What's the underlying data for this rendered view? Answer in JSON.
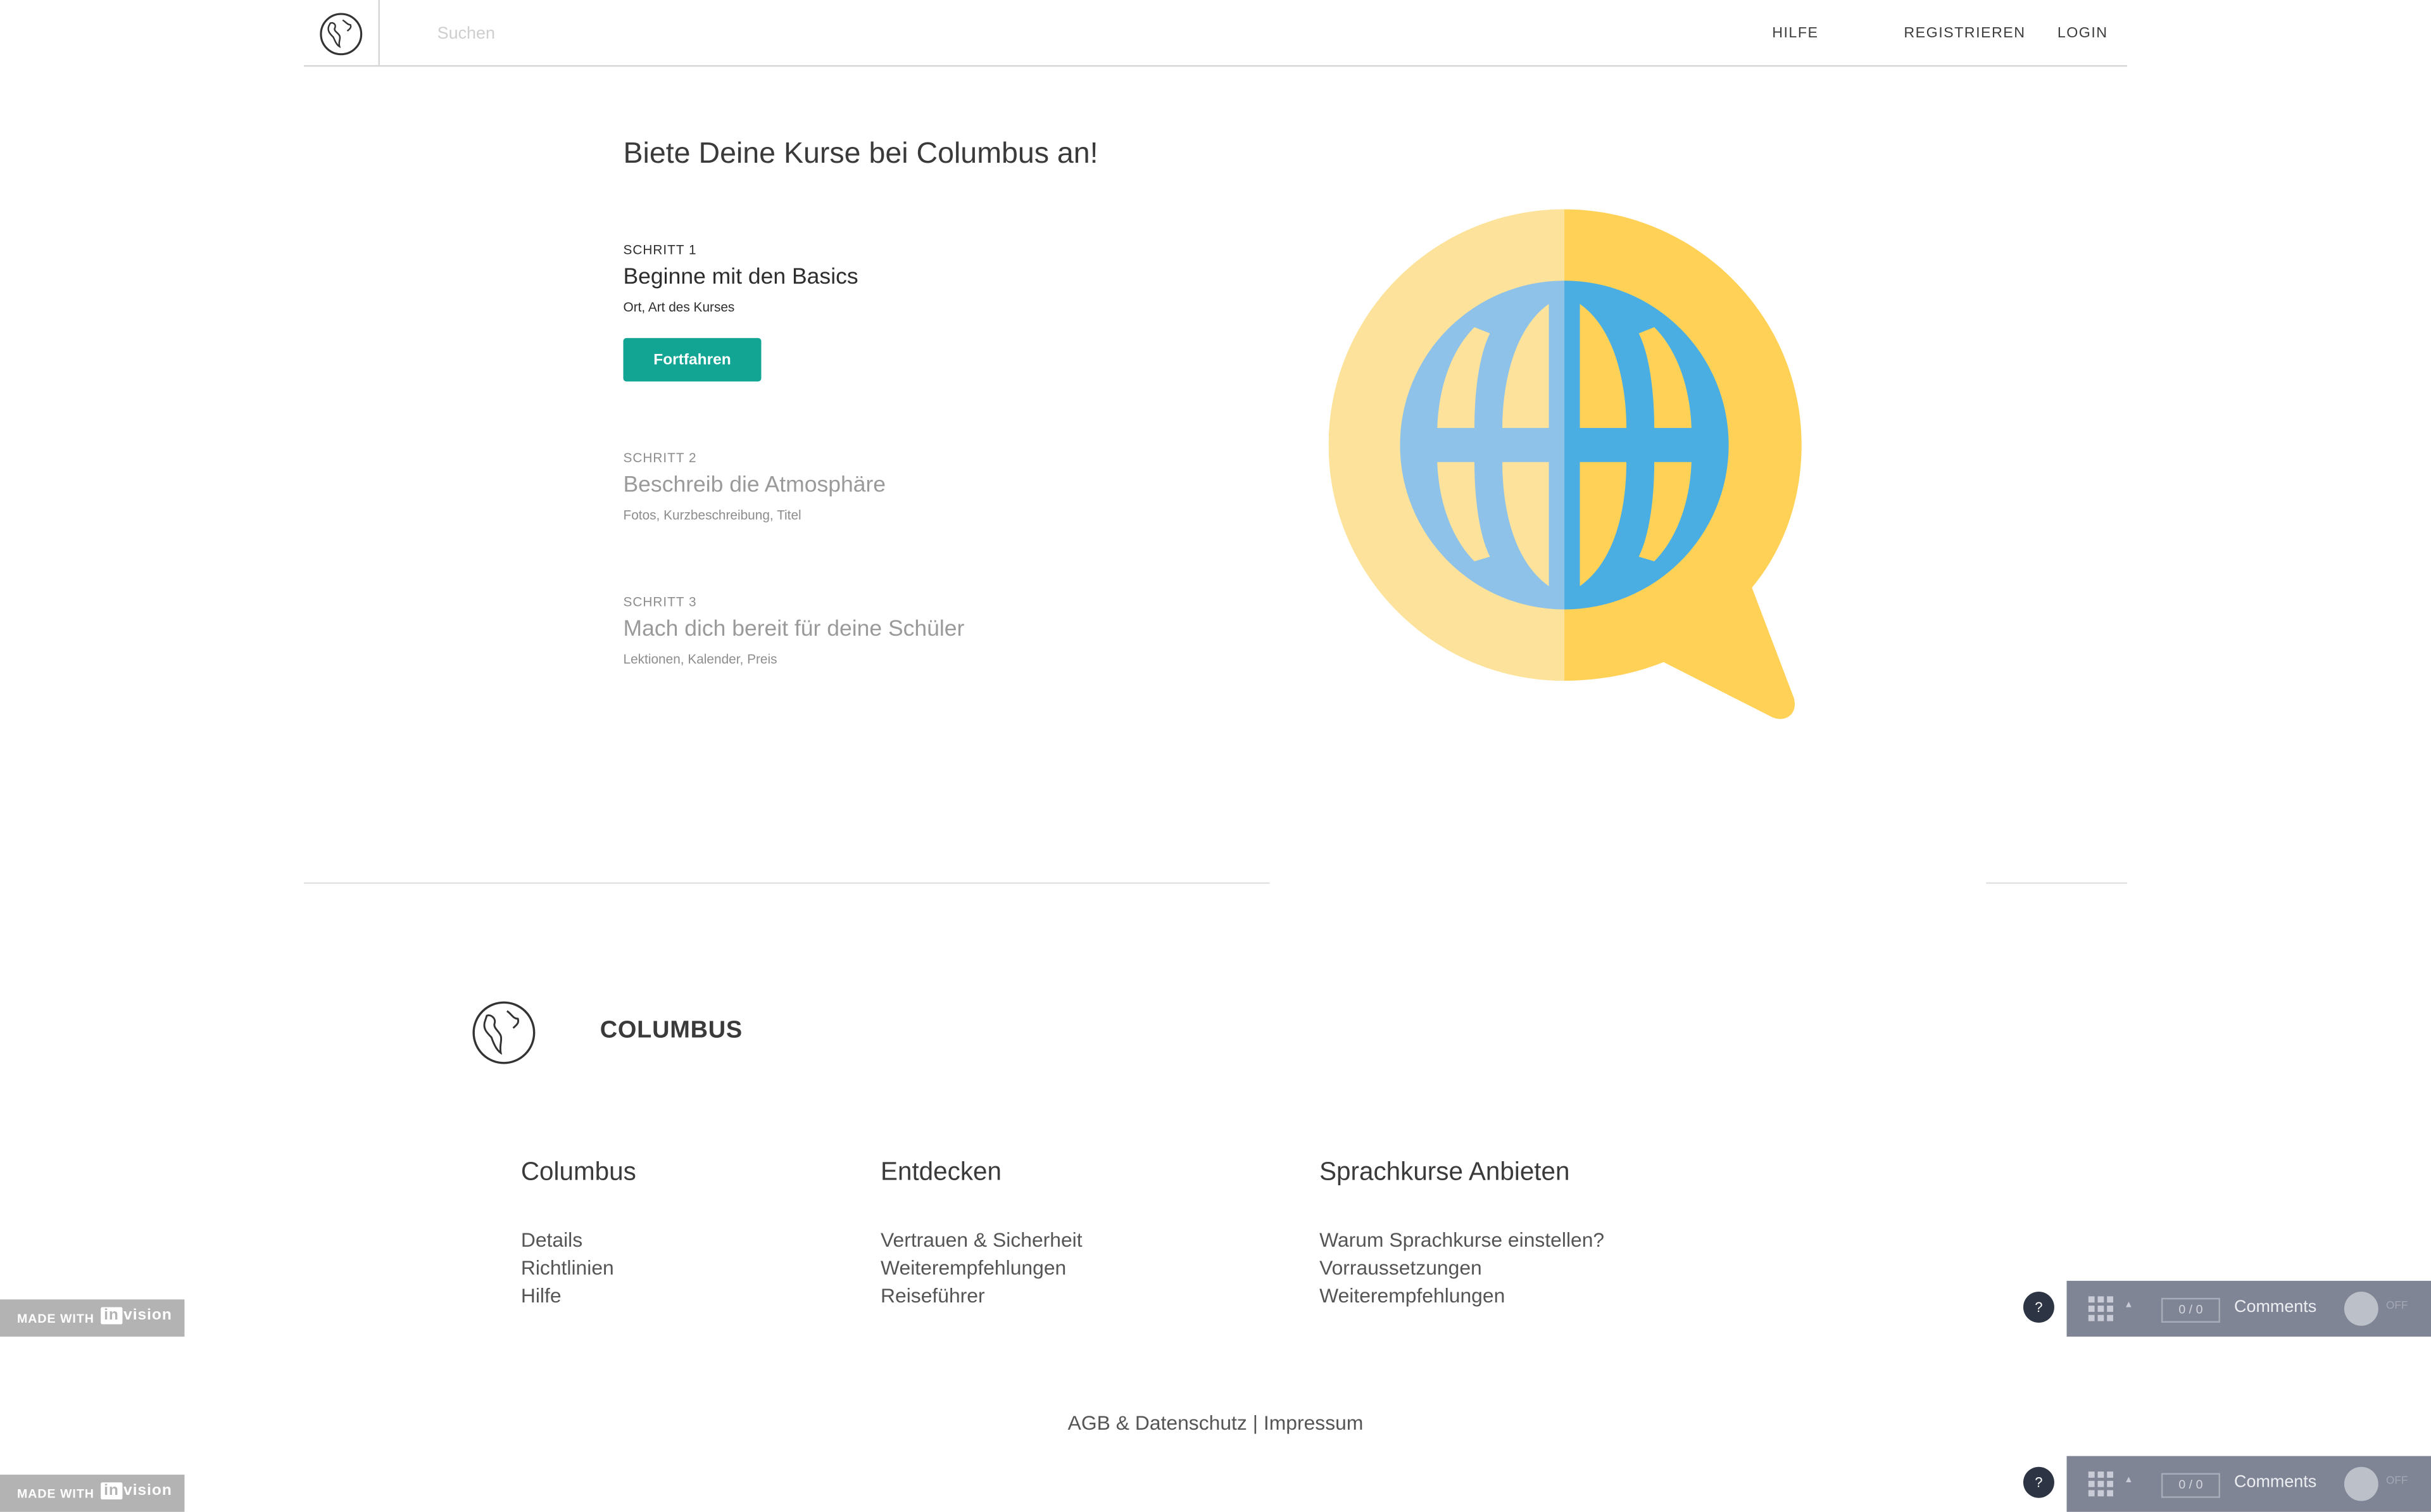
{
  "header": {
    "search_placeholder": "Suchen",
    "nav": {
      "help": "HILFE",
      "register": "REGISTRIEREN",
      "login": "LOGIN"
    }
  },
  "hero": {
    "title": "Biete Deine Kurse bei Columbus an!",
    "steps": [
      {
        "label": "SCHRITT 1",
        "title": "Beginne mit den Basics",
        "subtitle": "Ort, Art des Kurses",
        "state": "active"
      },
      {
        "label": "SCHRITT 2",
        "title": "Beschreib die Atmosphäre",
        "subtitle": "Fotos, Kurzbeschreibung, Titel",
        "state": "inactive"
      },
      {
        "label": "SCHRITT 3",
        "title": "Mach dich bereit für deine Schüler",
        "subtitle": "Lektionen, Kalender, Preis",
        "state": "inactive"
      }
    ],
    "continue_label": "Fortfahren",
    "illustration_icon": "globe-speech-bubble-icon"
  },
  "footer": {
    "brand": "COLUMBUS",
    "columns": [
      {
        "heading": "Columbus",
        "links": [
          "Details",
          "Richtlinien",
          "Hilfe"
        ]
      },
      {
        "heading": "Entdecken",
        "links": [
          "Vertrauen & Sicherheit",
          "Weiterempfehlungen",
          "Reiseführer"
        ]
      },
      {
        "heading": "Sprachkurse Anbieten",
        "links": [
          "Warum Sprachkurse einstellen?",
          "Vorraussetzungen",
          "Weiterempfehlungen"
        ]
      }
    ],
    "legal": {
      "agb": "AGB & Datenschutz",
      "sep": "|",
      "imprint": "Impressum"
    }
  },
  "invision": {
    "badge_made": "MADE WITH",
    "badge_brand_in": "in",
    "badge_brand_vision": "vision",
    "help": "?",
    "count": "0 / 0",
    "comments": "Comments",
    "toggle": "OFF"
  },
  "colors": {
    "accent": "#12a594",
    "text": "#3a3a3a",
    "muted": "#9a9a9a",
    "bubble_light": "#fde29b",
    "bubble_dark": "#ffd257",
    "globe_light": "#8ec2e8",
    "globe_dark": "#4aaee3",
    "invision_bar": "#808596"
  }
}
